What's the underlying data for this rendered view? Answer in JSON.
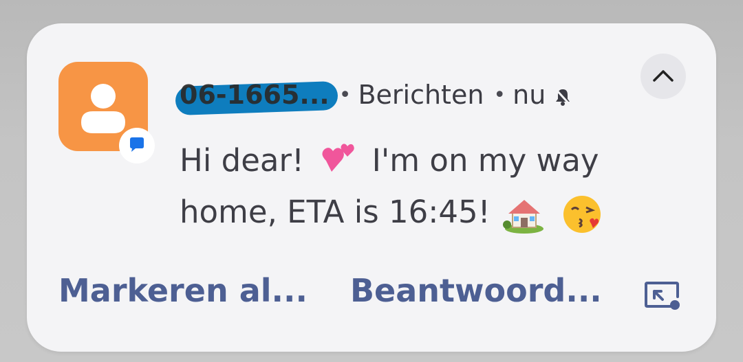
{
  "notification": {
    "sender": "06-1665...",
    "separator_1": "•",
    "app_name": "Berichten",
    "separator_2": "•",
    "time": "nu",
    "message_line_1": "Hi dear!",
    "message_line_1b": "I'm on my way",
    "message_line_2": "home, ETA is 16:45!",
    "emojis": [
      "two-hearts",
      "house-with-garden",
      "face-blowing-kiss"
    ],
    "icons": [
      "person-avatar-icon",
      "messages-badge-icon",
      "silent-bell-icon",
      "chevron-up-icon",
      "expand-to-window-icon"
    ],
    "colors": {
      "avatar": "#f79545",
      "badge_accent": "#1a73e8",
      "action_text": "#4d5f93",
      "sender_scribble": "#0e7dbe"
    }
  },
  "actions": {
    "mark_read": "Markeren al...",
    "reply": "Beantwoord..."
  }
}
